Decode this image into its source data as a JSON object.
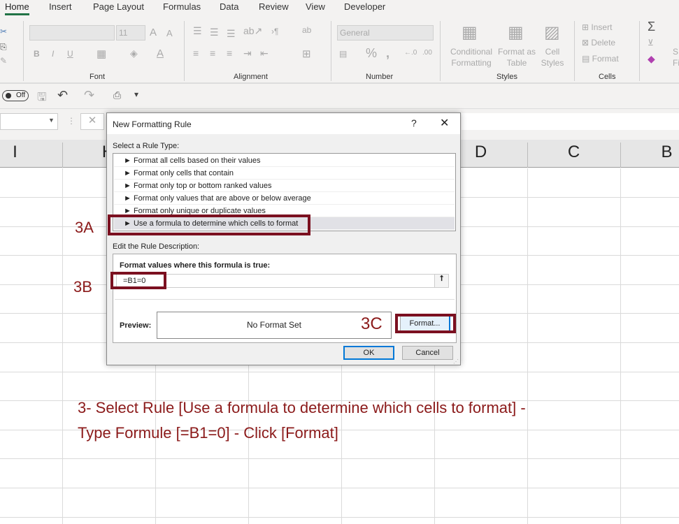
{
  "ribbon": {
    "tabs": [
      "Home",
      "Insert",
      "Page Layout",
      "Formulas",
      "Data",
      "Review",
      "View",
      "Developer"
    ],
    "active_tab": "Home",
    "font_size": "11",
    "number_format": "General",
    "groups": {
      "font": "Font",
      "alignment": "Alignment",
      "number": "Number",
      "styles": "Styles",
      "cells": "Cells"
    },
    "styles": {
      "conditional": [
        "Conditional",
        "Formatting"
      ],
      "format_table": [
        "Format as",
        "Table"
      ],
      "cell_styles": [
        "Cell",
        "Styles"
      ]
    },
    "cells": {
      "insert": "Insert",
      "delete": "Delete",
      "format": "Format"
    },
    "editing_partial": [
      "S",
      "Fi"
    ]
  },
  "qat": {
    "autosave": "Off"
  },
  "columns": [
    "I",
    "H",
    "D",
    "C",
    "B"
  ],
  "dialog": {
    "title": "New Formatting Rule",
    "help": "?",
    "select_label": "Select a Rule Type:",
    "rules": [
      "Format all cells based on their values",
      "Format only cells that contain",
      "Format only top or bottom ranked values",
      "Format only values that are above or below average",
      "Format only unique or duplicate values",
      "Use a formula to determine which cells to format"
    ],
    "selected_rule": 5,
    "edit_label": "Edit the Rule Description:",
    "formula_label": "Format values where this formula is true:",
    "formula_value": "=B1=0",
    "preview_label": "Preview:",
    "preview_text": "No Format Set",
    "format_button": "Format...",
    "ok": "OK",
    "cancel": "Cancel"
  },
  "annotations": {
    "a": "3A",
    "b": "3B",
    "c": "3C",
    "instruction_line1": "3- Select Rule [Use a formula to determine which cells to format] -",
    "instruction_line2": "Type Formule [=B1=0] - Click [Format]"
  },
  "colors": {
    "annotation": "#7b1020",
    "excel_green": "#217346",
    "ok_border": "#0078d7"
  }
}
